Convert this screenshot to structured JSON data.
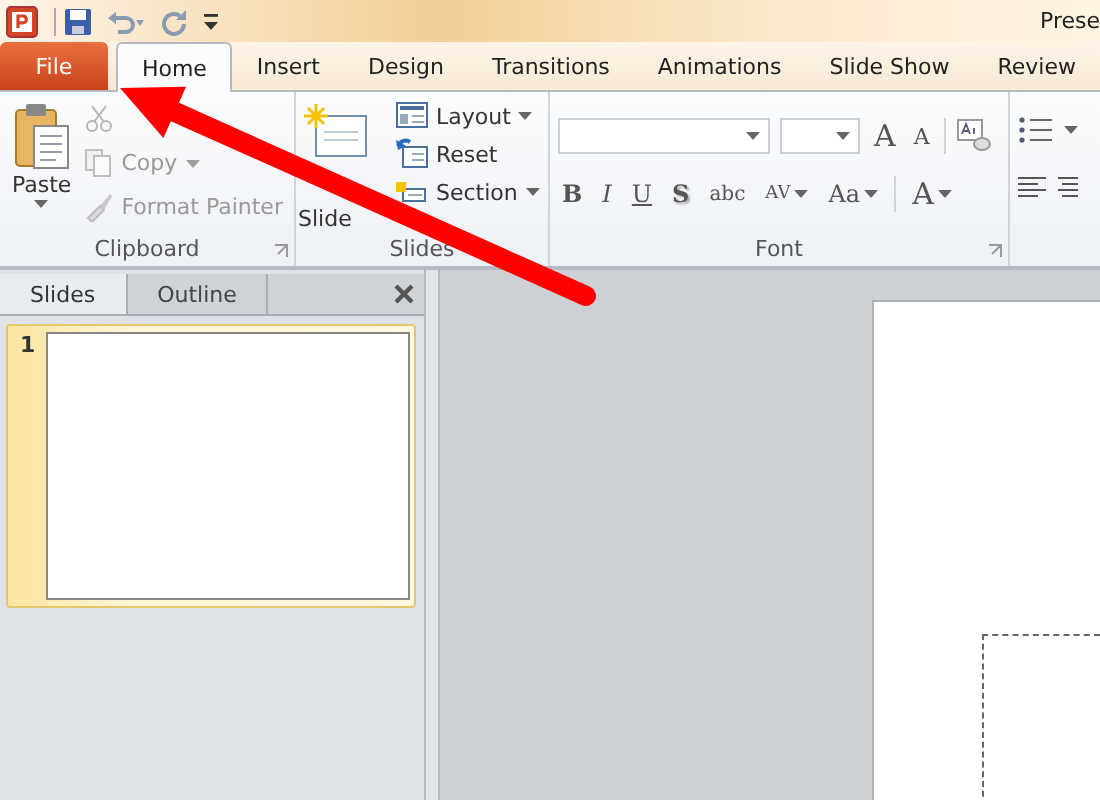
{
  "title_bar": {
    "title": "Prese"
  },
  "tabs": [
    {
      "label": "File",
      "kind": "file",
      "selected": false
    },
    {
      "label": "Home",
      "kind": "tab",
      "selected": true
    },
    {
      "label": "Insert",
      "kind": "tab",
      "selected": false
    },
    {
      "label": "Design",
      "kind": "tab",
      "selected": false
    },
    {
      "label": "Transitions",
      "kind": "tab",
      "selected": false
    },
    {
      "label": "Animations",
      "kind": "tab",
      "selected": false
    },
    {
      "label": "Slide Show",
      "kind": "tab",
      "selected": false
    },
    {
      "label": "Review",
      "kind": "tab",
      "selected": false
    }
  ],
  "clipboard": {
    "label": "Clipboard",
    "paste": "Paste",
    "items": [
      {
        "disabled": true,
        "dropdown": false
      },
      {
        "label": "Copy",
        "disabled": true,
        "dropdown": true
      },
      {
        "label": "Format Painter",
        "disabled": true,
        "dropdown": false
      }
    ]
  },
  "slides_group": {
    "label": "Slides",
    "new_slide": "Slide",
    "items": [
      {
        "label": "Layout",
        "dropdown": true
      },
      {
        "label": "Reset",
        "dropdown": false
      },
      {
        "label": "Section",
        "dropdown": true
      }
    ]
  },
  "font": {
    "label": "Font",
    "size_buttons": [
      "A",
      "A"
    ],
    "format_buttons": [
      {
        "label": "B",
        "dropdown": false
      },
      {
        "label": "I",
        "dropdown": false
      },
      {
        "label": "U",
        "dropdown": false
      },
      {
        "label": "S",
        "dropdown": false
      },
      {
        "label": "abc",
        "dropdown": false
      },
      {
        "label": "AV",
        "dropdown": true
      },
      {
        "label": "Aa",
        "dropdown": true
      },
      {
        "label": "A",
        "dropdown": true
      }
    ]
  },
  "pane": {
    "tabs": [
      {
        "label": "Slides",
        "selected": true
      },
      {
        "label": "Outline",
        "selected": false
      }
    ],
    "thumbnails": [
      {
        "number": "1",
        "selected": true
      }
    ]
  }
}
